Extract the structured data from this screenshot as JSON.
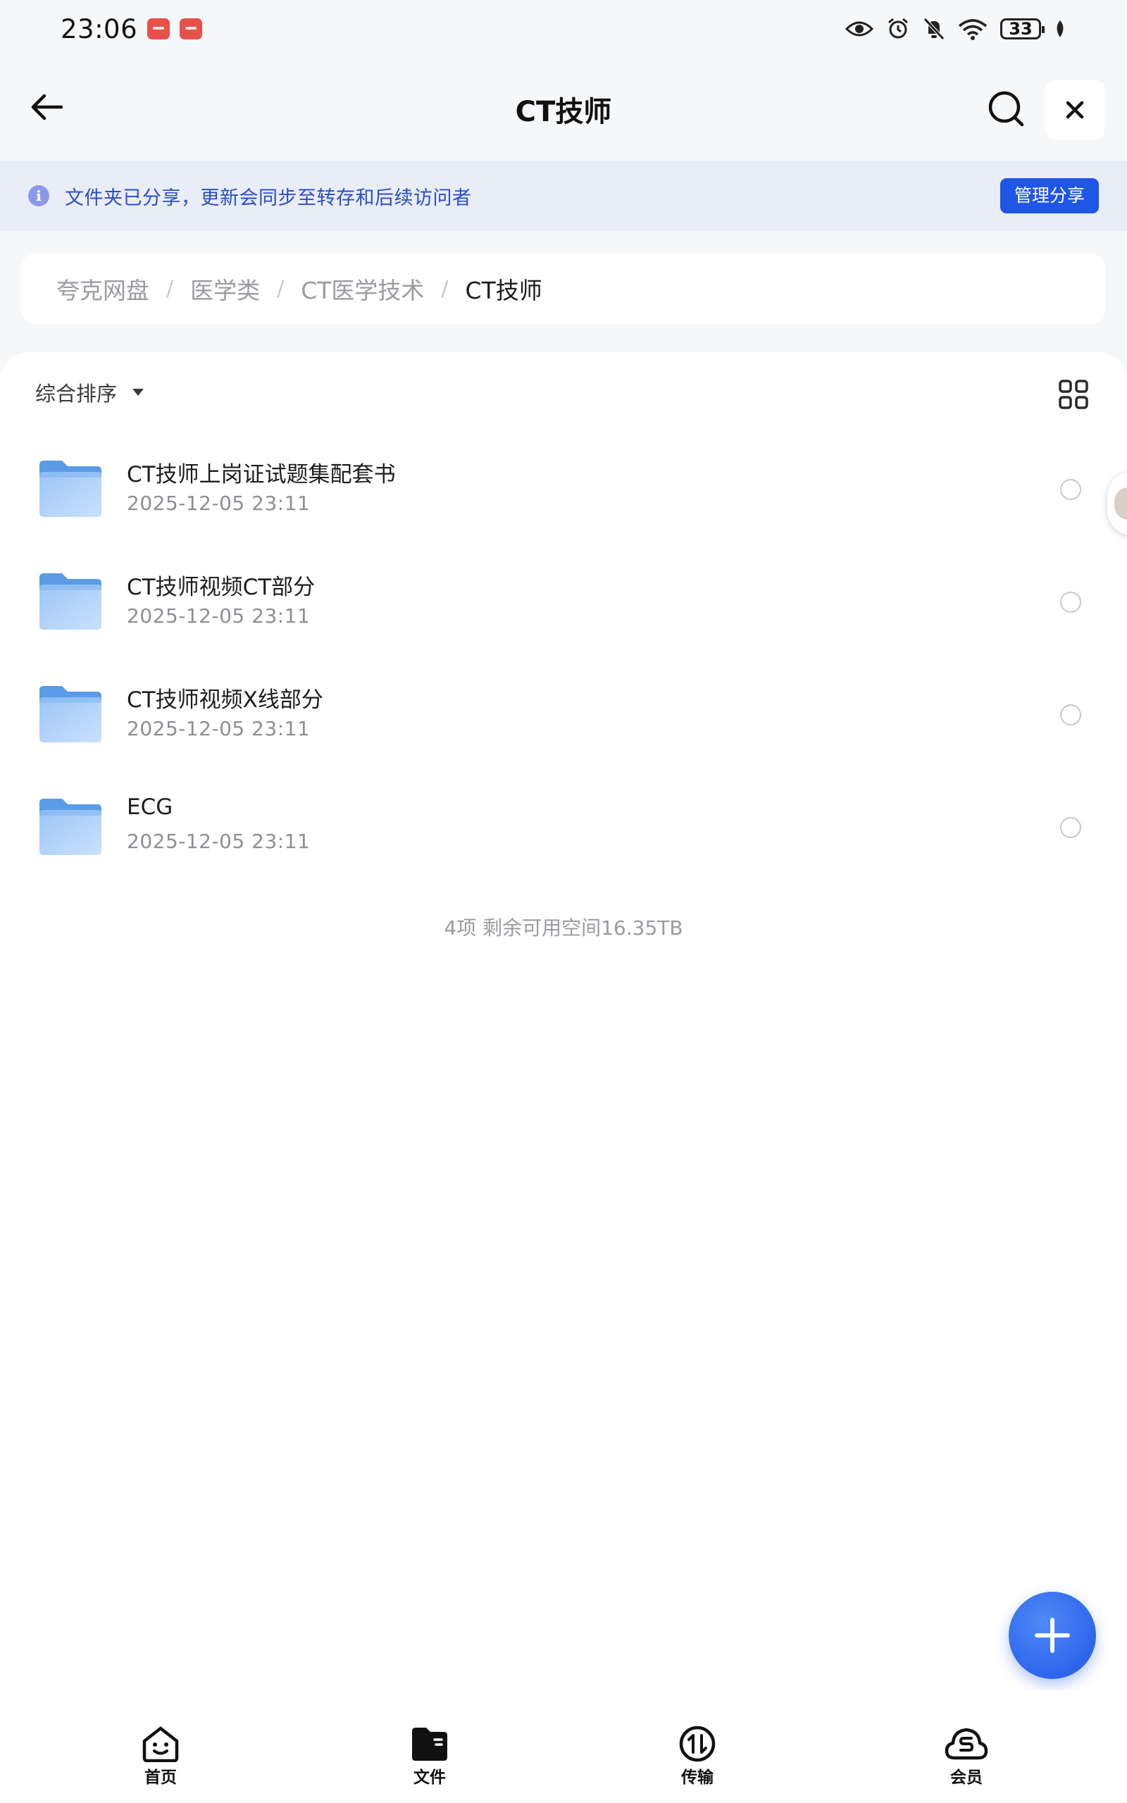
{
  "status_bar": {
    "time": "23:06",
    "battery": "33"
  },
  "header": {
    "title": "CT技师"
  },
  "share_banner": {
    "info_glyph": "i",
    "text": "文件夹已分享，更新会同步至转存和后续访问者",
    "manage_button": "管理分享",
    "accent_color": "#1f56e6"
  },
  "breadcrumb": {
    "items": [
      "夸克网盘",
      "医学类",
      "CT医学技术",
      "CT技师"
    ],
    "separator": "/"
  },
  "toolbar": {
    "sort_label": "综合排序"
  },
  "files": [
    {
      "name": "CT技师上岗证试题集配套书",
      "date": "2025-12-05 23:11",
      "type": "folder"
    },
    {
      "name": "CT技师视频CT部分",
      "date": "2025-12-05 23:11",
      "type": "folder"
    },
    {
      "name": "CT技师视频X线部分",
      "date": "2025-12-05 23:11",
      "type": "folder"
    },
    {
      "name": "ECG",
      "date": "2025-12-05 23:11",
      "type": "folder"
    }
  ],
  "summary": "4项 剩余可用空间16.35TB",
  "bottom_nav": [
    {
      "label": "首页",
      "icon": "home-face-icon"
    },
    {
      "label": "文件",
      "icon": "folder-filled-icon"
    },
    {
      "label": "传输",
      "icon": "transfer-icon"
    },
    {
      "label": "会员",
      "icon": "vip-cloud-icon"
    }
  ]
}
